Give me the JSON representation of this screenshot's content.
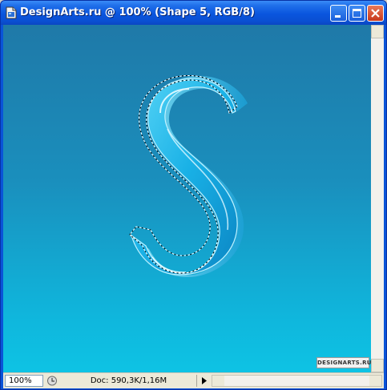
{
  "window": {
    "title": "DesignArts.ru @ 100% (Shape 5, RGB/8)",
    "colors": {
      "titlebar": "#0a55de",
      "canvas_top": "#1f79a8",
      "canvas_bottom": "#0ec3e4",
      "glass": "#1fb6ea"
    }
  },
  "canvas": {
    "watermark": "DESIGNARTS.RU"
  },
  "statusbar": {
    "zoom": "100%",
    "doc_info": "Doc: 590,3K/1,16M"
  },
  "icons": [
    "photoshop-doc-icon",
    "minimize-icon",
    "maximize-icon",
    "close-icon",
    "status-info-icon",
    "status-arrow-icon"
  ]
}
